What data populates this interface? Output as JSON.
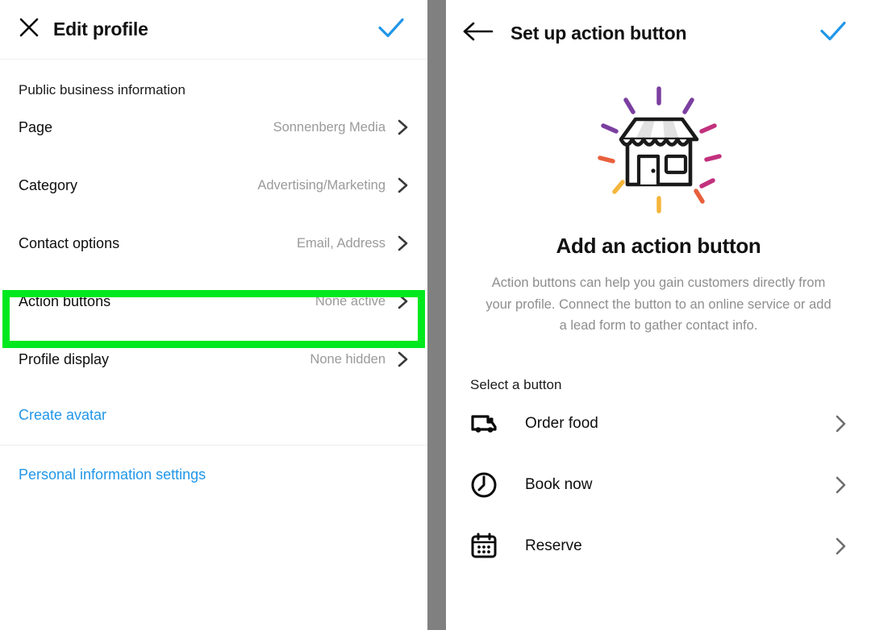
{
  "left_panel": {
    "header": {
      "close_icon": "close-icon",
      "title": "Edit profile",
      "confirm_icon": "check-icon"
    },
    "section_title": "Public business information",
    "rows": [
      {
        "label": "Page",
        "value": "Sonnenberg Media",
        "chevron": "chevron-right-icon"
      },
      {
        "label": "Category",
        "value": "Advertising/Marketing",
        "chevron": "chevron-right-icon"
      },
      {
        "label": "Contact options",
        "value": "Email, Address",
        "chevron": "chevron-right-icon"
      },
      {
        "label": "Action buttons",
        "value": "None active",
        "chevron": "chevron-right-icon"
      },
      {
        "label": "Profile display",
        "value": "None hidden",
        "chevron": "chevron-right-icon"
      }
    ],
    "create_avatar_link": "Create avatar",
    "personal_info_link": "Personal information settings",
    "highlight_color": "#00e81e",
    "highlighted_row": "Action buttons"
  },
  "right_panel": {
    "header": {
      "back_icon": "arrow-left-icon",
      "title": "Set up action button",
      "confirm_icon": "check-icon"
    },
    "hero": {
      "illustration": "storefront-icon",
      "title": "Add an action button",
      "description": "Action buttons can help you gain customers directly from your profile. Connect the button to an online service or add a lead form to gather contact info."
    },
    "select_label": "Select a button",
    "buttons": [
      {
        "label": "Order food",
        "icon": "delivery-truck-icon",
        "chevron": "chevron-right-icon"
      },
      {
        "label": "Book now",
        "icon": "clock-icon",
        "chevron": "chevron-right-icon"
      },
      {
        "label": "Reserve",
        "icon": "calendar-icon",
        "chevron": "chevron-right-icon"
      }
    ]
  },
  "colors": {
    "accent_blue": "#2196e8",
    "highlight_green": "#00e81e",
    "divider_gray": "#808080",
    "muted_text": "#9a9a9a",
    "ray_purple": "#7b3fa0",
    "ray_magenta": "#c2317e",
    "ray_orange": "#e8603c",
    "ray_yellow": "#f5b53c"
  }
}
